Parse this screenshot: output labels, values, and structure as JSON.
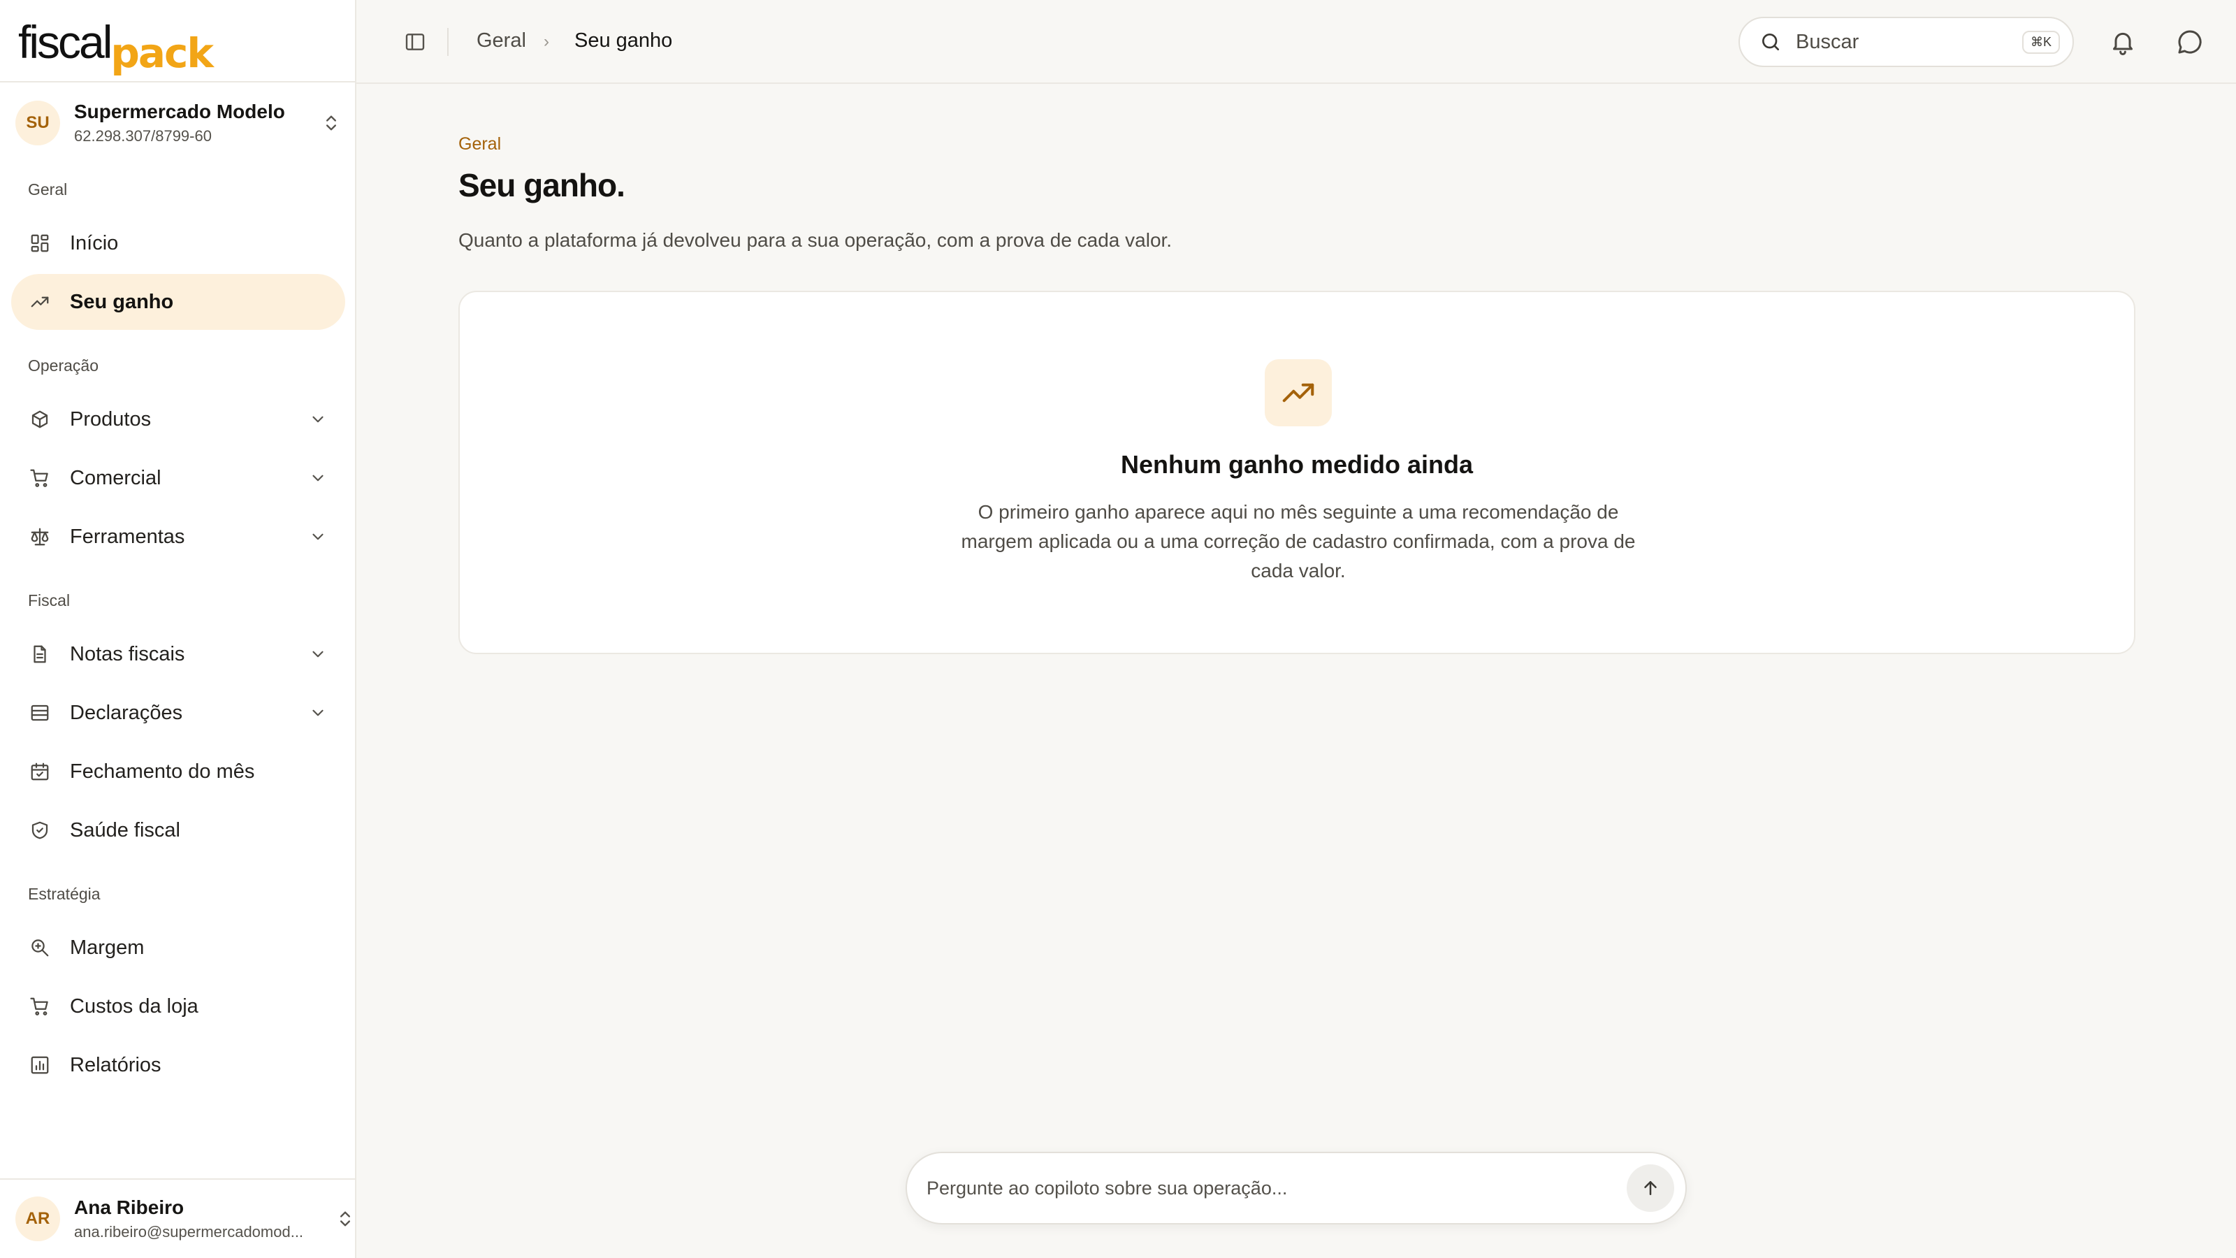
{
  "brand": {
    "part1": "fiscal",
    "part2": "pack"
  },
  "org": {
    "initials": "SU",
    "name": "Supermercado Modelo",
    "cnpj": "62.298.307/8799-60"
  },
  "sidebar": {
    "sections": [
      {
        "label": "Geral"
      },
      {
        "label": "Operação"
      },
      {
        "label": "Fiscal"
      },
      {
        "label": "Estratégia"
      }
    ],
    "items": [
      {
        "label": "Início",
        "icon": "dashboard-icon"
      },
      {
        "label": "Seu ganho",
        "icon": "trending-up-icon",
        "active": true
      },
      {
        "label": "Produtos",
        "icon": "box-icon",
        "expandable": true
      },
      {
        "label": "Comercial",
        "icon": "cart-icon",
        "expandable": true
      },
      {
        "label": "Ferramentas",
        "icon": "scale-icon",
        "expandable": true
      },
      {
        "label": "Notas fiscais",
        "icon": "document-icon",
        "expandable": true
      },
      {
        "label": "Declarações",
        "icon": "stack-icon",
        "expandable": true
      },
      {
        "label": "Fechamento do mês",
        "icon": "calendar-check-icon"
      },
      {
        "label": "Saúde fiscal",
        "icon": "shield-check-icon"
      },
      {
        "label": "Margem",
        "icon": "zoom-icon"
      },
      {
        "label": "Custos da loja",
        "icon": "cart-icon"
      },
      {
        "label": "Relatórios",
        "icon": "bar-chart-icon"
      }
    ]
  },
  "user": {
    "initials": "AR",
    "name": "Ana Ribeiro",
    "email": "ana.ribeiro@supermercadomod..."
  },
  "topbar": {
    "breadcrumb": [
      "Geral",
      "Seu ganho"
    ],
    "search_placeholder": "Buscar",
    "search_shortcut": "⌘K"
  },
  "main": {
    "eyebrow": "Geral",
    "title": "Seu ganho.",
    "subtitle": "Quanto a plataforma já devolveu para a sua operação, com a prova de cada valor.",
    "empty": {
      "title": "Nenhum ganho medido ainda",
      "text": "O primeiro ganho aparece aqui no mês seguinte a uma recomendação de margem aplicada ou a uma correção de cadastro confirmada, com a prova de cada valor."
    }
  },
  "chat": {
    "placeholder": "Pergunte ao copiloto sobre sua operação..."
  },
  "colors": {
    "accent": "#f2a516",
    "accent_dark": "#a4620a",
    "accent_soft": "#fdf0dc",
    "background": "#f8f7f4"
  }
}
